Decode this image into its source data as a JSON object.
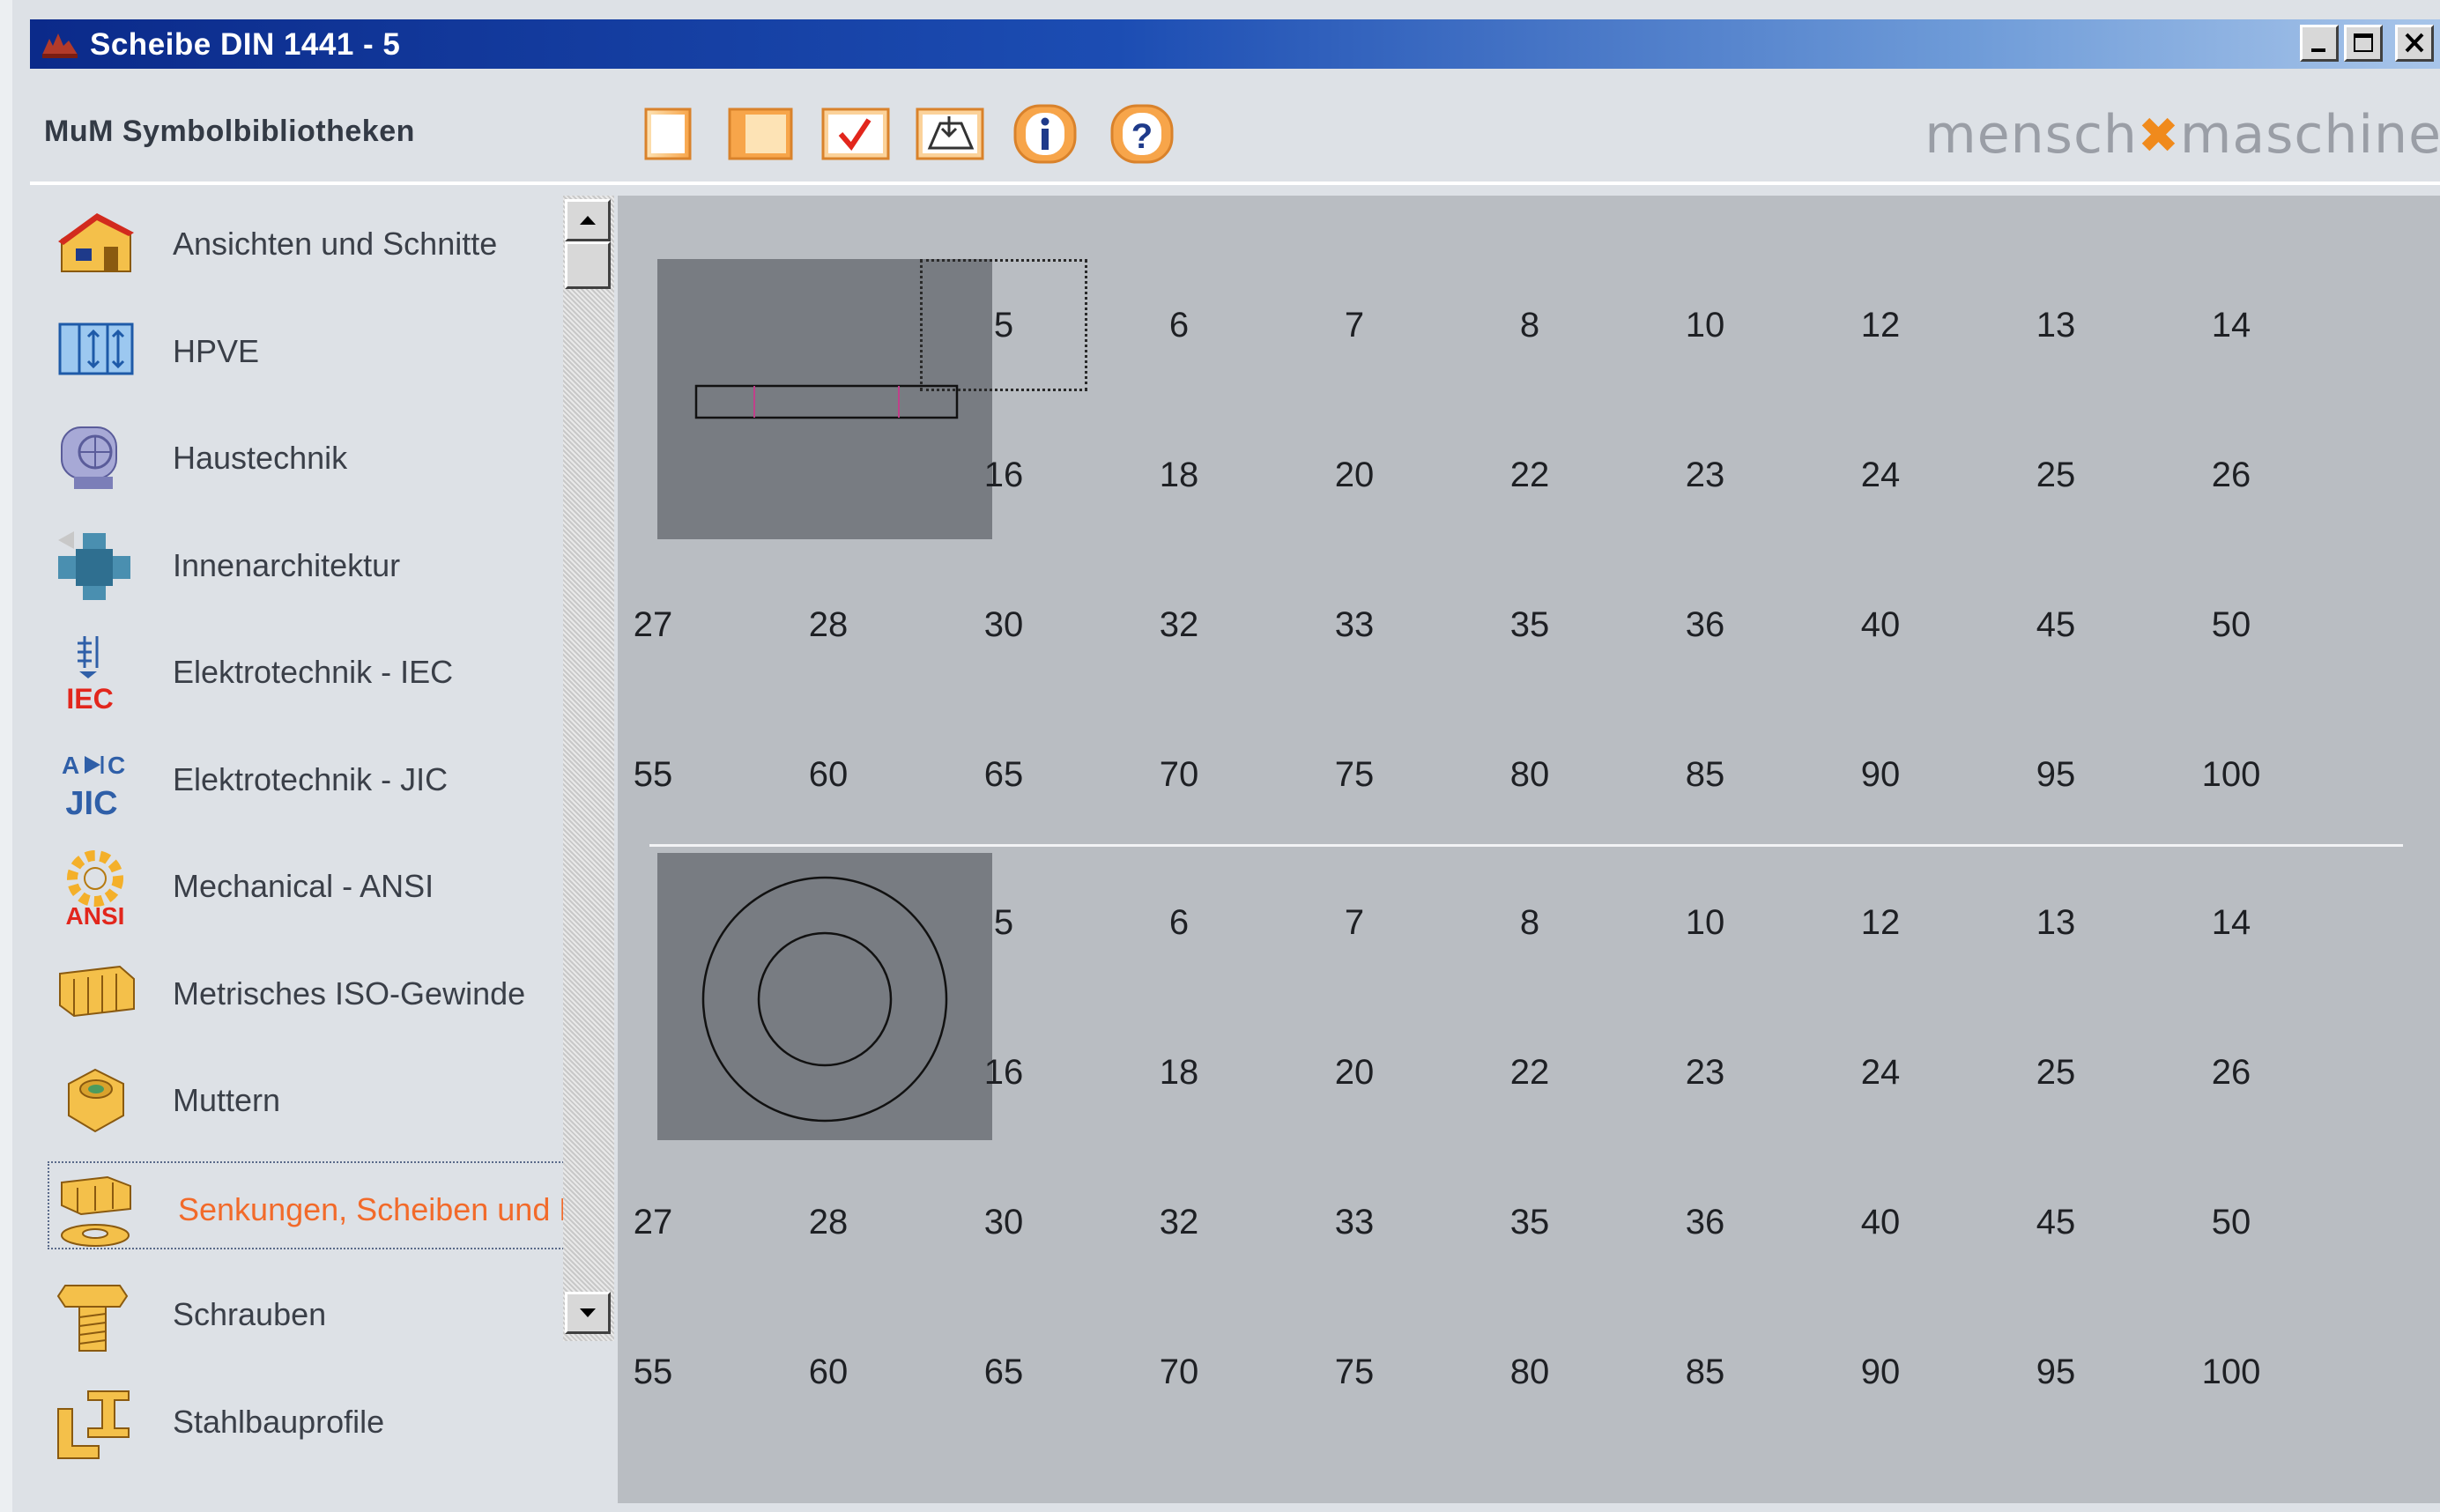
{
  "window": {
    "title": "Scheibe DIN 1441 - 5",
    "controls": [
      "minimize",
      "maximize",
      "close"
    ]
  },
  "toolbar": {
    "library_label": "MuM Symbolbibliotheken",
    "brand_left": "mensch",
    "brand_right": "maschine",
    "buttons": [
      {
        "name": "new-icon"
      },
      {
        "name": "open-icon"
      },
      {
        "name": "check-icon"
      },
      {
        "name": "insert-icon"
      },
      {
        "name": "info-icon"
      },
      {
        "name": "help-icon"
      }
    ]
  },
  "sidebar": {
    "items": [
      {
        "label": "Ansichten und Schnitte",
        "icon": "house-icon",
        "selected": false
      },
      {
        "label": "HPVE",
        "icon": "hpve-icon",
        "selected": false
      },
      {
        "label": "Haustechnik",
        "icon": "hvac-icon",
        "selected": false
      },
      {
        "label": "Innenarchitektur",
        "icon": "interior-icon",
        "selected": false
      },
      {
        "label": "Elektrotechnik - IEC",
        "icon": "iec-icon",
        "selected": false
      },
      {
        "label": "Elektrotechnik - JIC",
        "icon": "jic-icon",
        "selected": false
      },
      {
        "label": "Mechanical - ANSI",
        "icon": "ansi-icon",
        "selected": false
      },
      {
        "label": "Metrisches ISO-Gewinde",
        "icon": "thread-icon",
        "selected": false
      },
      {
        "label": "Muttern",
        "icon": "nut-icon",
        "selected": false
      },
      {
        "label": "Senkungen, Scheiben und Du",
        "icon": "washer-icon",
        "selected": true
      },
      {
        "label": "Schrauben",
        "icon": "screw-icon",
        "selected": false
      },
      {
        "label": "Stahlbauprofile",
        "icon": "steel-profile-icon",
        "selected": false
      }
    ]
  },
  "main": {
    "sections": [
      {
        "view": "side",
        "sizes": [
          "5",
          "6",
          "7",
          "8",
          "10",
          "12",
          "13",
          "14",
          "16",
          "18",
          "20",
          "22",
          "23",
          "24",
          "25",
          "26",
          "27",
          "28",
          "30",
          "32",
          "33",
          "35",
          "36",
          "40",
          "45",
          "50",
          "55",
          "60",
          "65",
          "70",
          "75",
          "80",
          "85",
          "90",
          "95",
          "100"
        ],
        "focused": "5"
      },
      {
        "view": "top",
        "sizes": [
          "5",
          "6",
          "7",
          "8",
          "10",
          "12",
          "13",
          "14",
          "16",
          "18",
          "20",
          "22",
          "23",
          "24",
          "25",
          "26",
          "27",
          "28",
          "30",
          "32",
          "33",
          "35",
          "36",
          "40",
          "45",
          "50",
          "55",
          "60",
          "65",
          "70",
          "75",
          "80",
          "85",
          "90",
          "95",
          "100"
        ],
        "focused": null
      }
    ]
  }
}
